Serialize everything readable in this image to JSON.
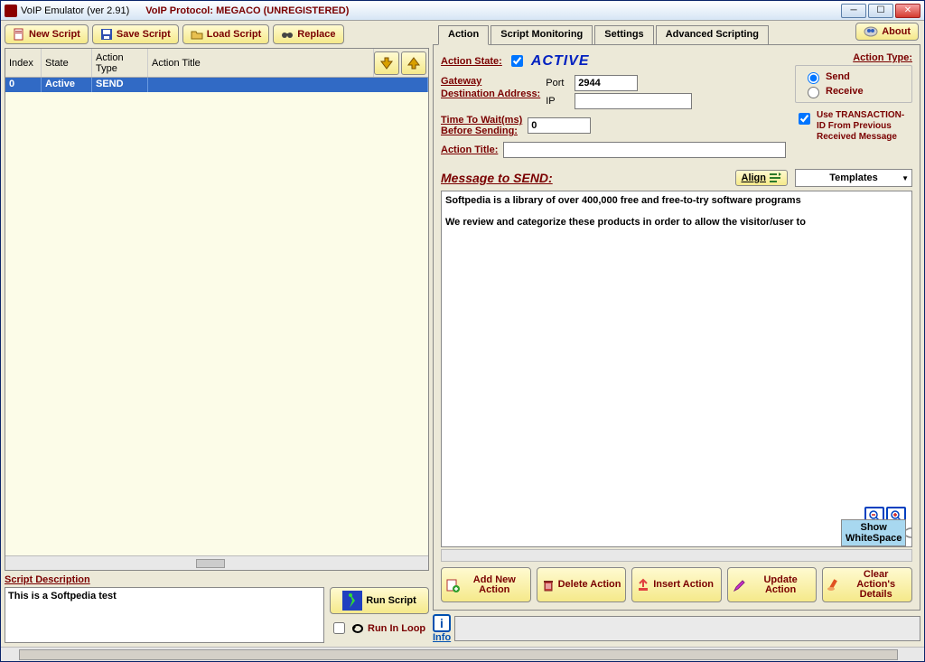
{
  "window": {
    "title": "VoIP Emulator  (ver 2.91)",
    "protocol": "VoIP Protocol: MEGACO  (UNREGISTERED)"
  },
  "toolbar": {
    "new": "New Script",
    "save": "Save Script",
    "load": "Load Script",
    "replace": "Replace"
  },
  "table": {
    "headers": {
      "index": "Index",
      "state": "State",
      "atype": "Action Type",
      "atitle": "Action Title"
    },
    "rows": [
      {
        "index": "0",
        "state": "Active",
        "atype": "SEND",
        "atitle": ""
      }
    ]
  },
  "scriptDesc": {
    "label": "Script Description",
    "text": "This is a Softpedia test",
    "runScript": "Run Script",
    "runInLoop": "Run In Loop"
  },
  "about": "About",
  "tabs": {
    "action": "Action",
    "monitoring": "Script Monitoring",
    "settings": "Settings",
    "advanced": "Advanced Scripting"
  },
  "action": {
    "stateLabel": "Action State:",
    "stateValue": "ACTIVE",
    "typeLabel": "Action Type:",
    "send": "Send",
    "receive": "Receive",
    "gatewayLabel": "Gateway Destination Address:",
    "portLabel": "Port",
    "portVal": "2944",
    "ipLabel": "IP",
    "ipVal": "",
    "useTid": "Use TRANSACTION-ID From Previous Received Message",
    "waitLabel": "Time To Wait(ms) Before Sending:",
    "waitVal": "0",
    "titleLabel": "Action Title:",
    "titleVal": "",
    "msgLabel": "Message to SEND:",
    "align": "Align",
    "templates": "Templates",
    "msgText": "Softpedia is a library of over 400,000 free and free-to-try software programs\n\nWe review and categorize these products in order to allow the visitor/user to",
    "showWs": "Show WhiteSpace"
  },
  "actionBtns": {
    "add": "Add New Action",
    "delete": "Delete Action",
    "insert": "Insert Action",
    "update": "Update Action",
    "clear": "Clear Action's Details"
  },
  "info": {
    "label": "Info"
  }
}
